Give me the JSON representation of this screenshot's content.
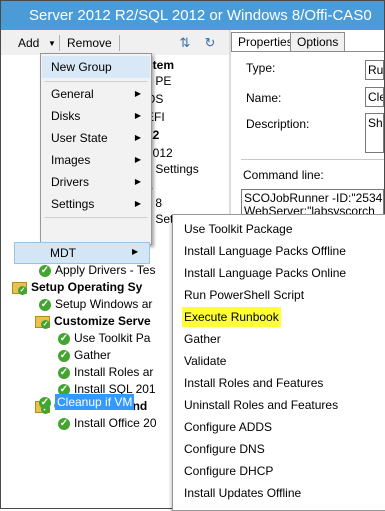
{
  "window": {
    "title": "Server 2012 R2/SQL 2012 or Windows 8/Offi-CAS0"
  },
  "toolbar": {
    "add_label": "Add",
    "remove_label": "Remove"
  },
  "tree": {
    "items": [
      {
        "label": "stem",
        "bold": true
      },
      {
        "label": "s PE"
      },
      {
        "label": "OS"
      },
      {
        "label": "EFI"
      },
      {
        "label": "12",
        "bold": true
      },
      {
        "label": "2012"
      },
      {
        "label": "s Settings"
      },
      {
        "label": "8",
        "bold": true
      },
      {
        "label": "s 8"
      },
      {
        "label": "s Settings"
      },
      {
        "label": "Apply Drivers - Tes"
      },
      {
        "label": "Setup Operating Sy",
        "bold": true
      },
      {
        "label": "Setup Windows ar"
      },
      {
        "label": "Customize Serve",
        "bold": true
      },
      {
        "label": "Use Toolkit Pa"
      },
      {
        "label": "Gather"
      },
      {
        "label": "Install Roles ar"
      },
      {
        "label": "Install SQL 201"
      },
      {
        "label": "Customize Wind",
        "bold": true
      },
      {
        "label": "Install Office 20"
      },
      {
        "label": "Cleanup if VM"
      }
    ]
  },
  "tabs": [
    {
      "label": "Properties"
    },
    {
      "label": "Options"
    }
  ],
  "properties": {
    "type_label": "Type:",
    "type_value": "Ru",
    "name_label": "Name:",
    "name_value": "Cle",
    "description_label": "Description:",
    "description_value": "Sh",
    "command_label": "Command line:",
    "command_value_1": "SCOJobRunner -ID:\"253434",
    "command_value_2": "WebServer:\"labsyscorch"
  },
  "add_menu": {
    "items": [
      {
        "label": "New Group",
        "submenu": false
      },
      {
        "label": "General",
        "submenu": true
      },
      {
        "label": "Disks",
        "submenu": true
      },
      {
        "label": "User State",
        "submenu": true
      },
      {
        "label": "Images",
        "submenu": true
      },
      {
        "label": "Drivers",
        "submenu": true
      },
      {
        "label": "Settings",
        "submenu": true
      },
      {
        "label": "MDT",
        "submenu": true
      }
    ]
  },
  "mdt_menu": {
    "highlighted_color": "#ffff33",
    "items": [
      {
        "label": "Use Toolkit Package"
      },
      {
        "label": "Install Language Packs Offline"
      },
      {
        "label": "Install Language Packs Online"
      },
      {
        "label": "Run PowerShell Script"
      },
      {
        "label": "Execute Runbook",
        "highlighted": true
      },
      {
        "label": "Gather"
      },
      {
        "label": "Validate"
      },
      {
        "label": "Install Roles and Features"
      },
      {
        "label": "Uninstall Roles and Features"
      },
      {
        "label": "Configure ADDS"
      },
      {
        "label": "Configure DNS"
      },
      {
        "label": "Configure DHCP"
      },
      {
        "label": "Install Updates Offline"
      }
    ]
  },
  "colors": {
    "titlebar": "#4b9bd6",
    "selection": "#3399ff",
    "success": "#43a530"
  }
}
